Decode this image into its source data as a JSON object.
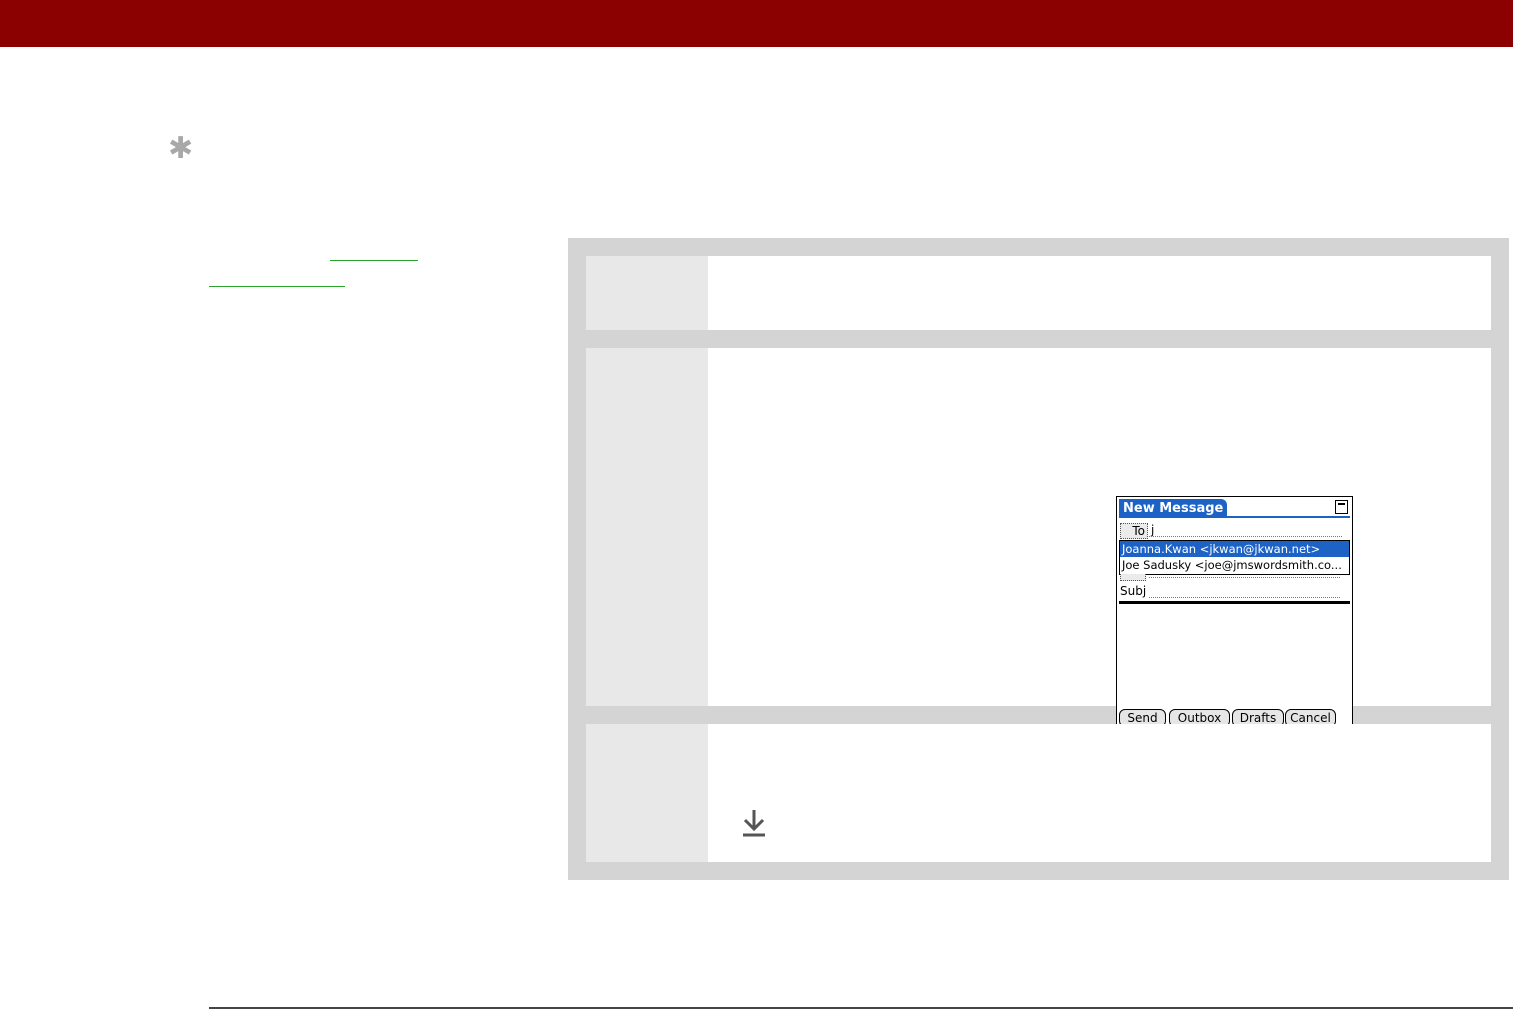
{
  "colors": {
    "header_bar": "#8b0000",
    "link_underline": "#2aa52a",
    "palm_accent": "#1d63c6"
  },
  "icons": {
    "tip": "asterisk-icon",
    "continue": "download-arrow-icon"
  },
  "tip": {
    "symbol": "✱"
  },
  "screenshot": {
    "title": "New Message",
    "to_label": "To",
    "to_value": "j",
    "suggestions": [
      "Joanna.Kwan <jkwan@jkwan.net>",
      "Joe Sadusky <joe@jmswordsmith.co..."
    ],
    "subj_label": "Subj",
    "buttons": {
      "send": "Send",
      "outbox": "Outbox",
      "drafts": "Drafts",
      "cancel": "Cancel"
    }
  }
}
